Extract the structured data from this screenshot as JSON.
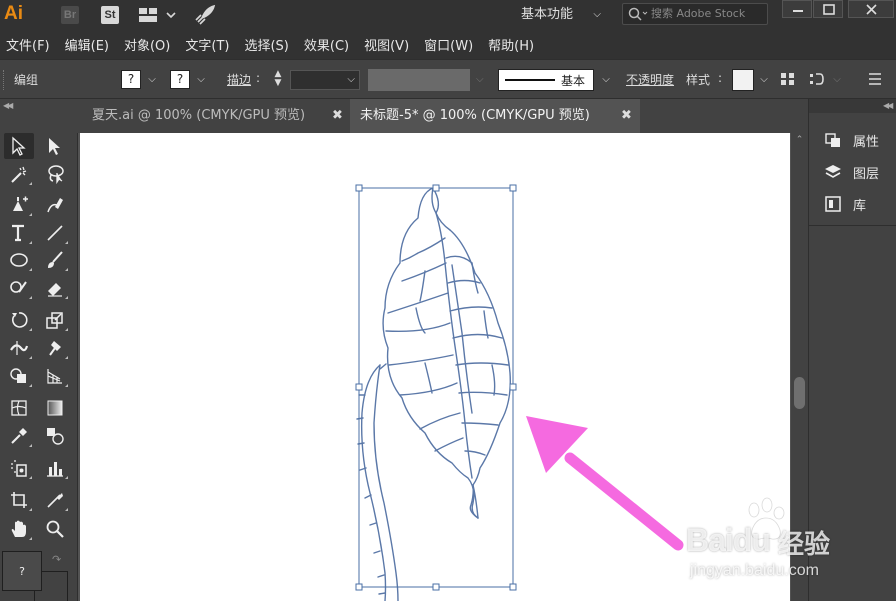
{
  "titlebar": {
    "logo": "Ai",
    "bridge_label": "Br",
    "stock_label": "St",
    "workspace_label": "基本功能",
    "search_placeholder": "搜索 Adobe Stock"
  },
  "menubar": {
    "items": [
      "文件(F)",
      "编辑(E)",
      "对象(O)",
      "文字(T)",
      "选择(S)",
      "效果(C)",
      "视图(V)",
      "窗口(W)",
      "帮助(H)"
    ]
  },
  "controlbar": {
    "selection_label": "编组",
    "fill_value": "?",
    "stroke_value": "?",
    "stroke_label": "描边",
    "stroke_colon": ":",
    "profile_label": "基本",
    "opacity_label": "不透明度",
    "style_label": "样式"
  },
  "tabs": [
    {
      "label": "夏天.ai @ 100% (CMYK/GPU 预览)",
      "active": false
    },
    {
      "label": "未标题-5* @ 100% (CMYK/GPU 预览)",
      "active": true
    }
  ],
  "toolbar": {
    "fill_swatch_label": "?"
  },
  "panels": [
    {
      "icon": "properties-icon",
      "label": "属性"
    },
    {
      "icon": "layers-icon",
      "label": "图层"
    },
    {
      "icon": "libraries-icon",
      "label": "库"
    }
  ],
  "watermark": {
    "brand": "Baidu",
    "brand_cn": "经验",
    "url": "jingyan.baidu.com"
  },
  "colors": {
    "artwork_stroke": "#5b78a8",
    "selection_frame": "#4a6fa5",
    "annotation_arrow": "#f56ae0",
    "app_logo": "#e98a13"
  }
}
